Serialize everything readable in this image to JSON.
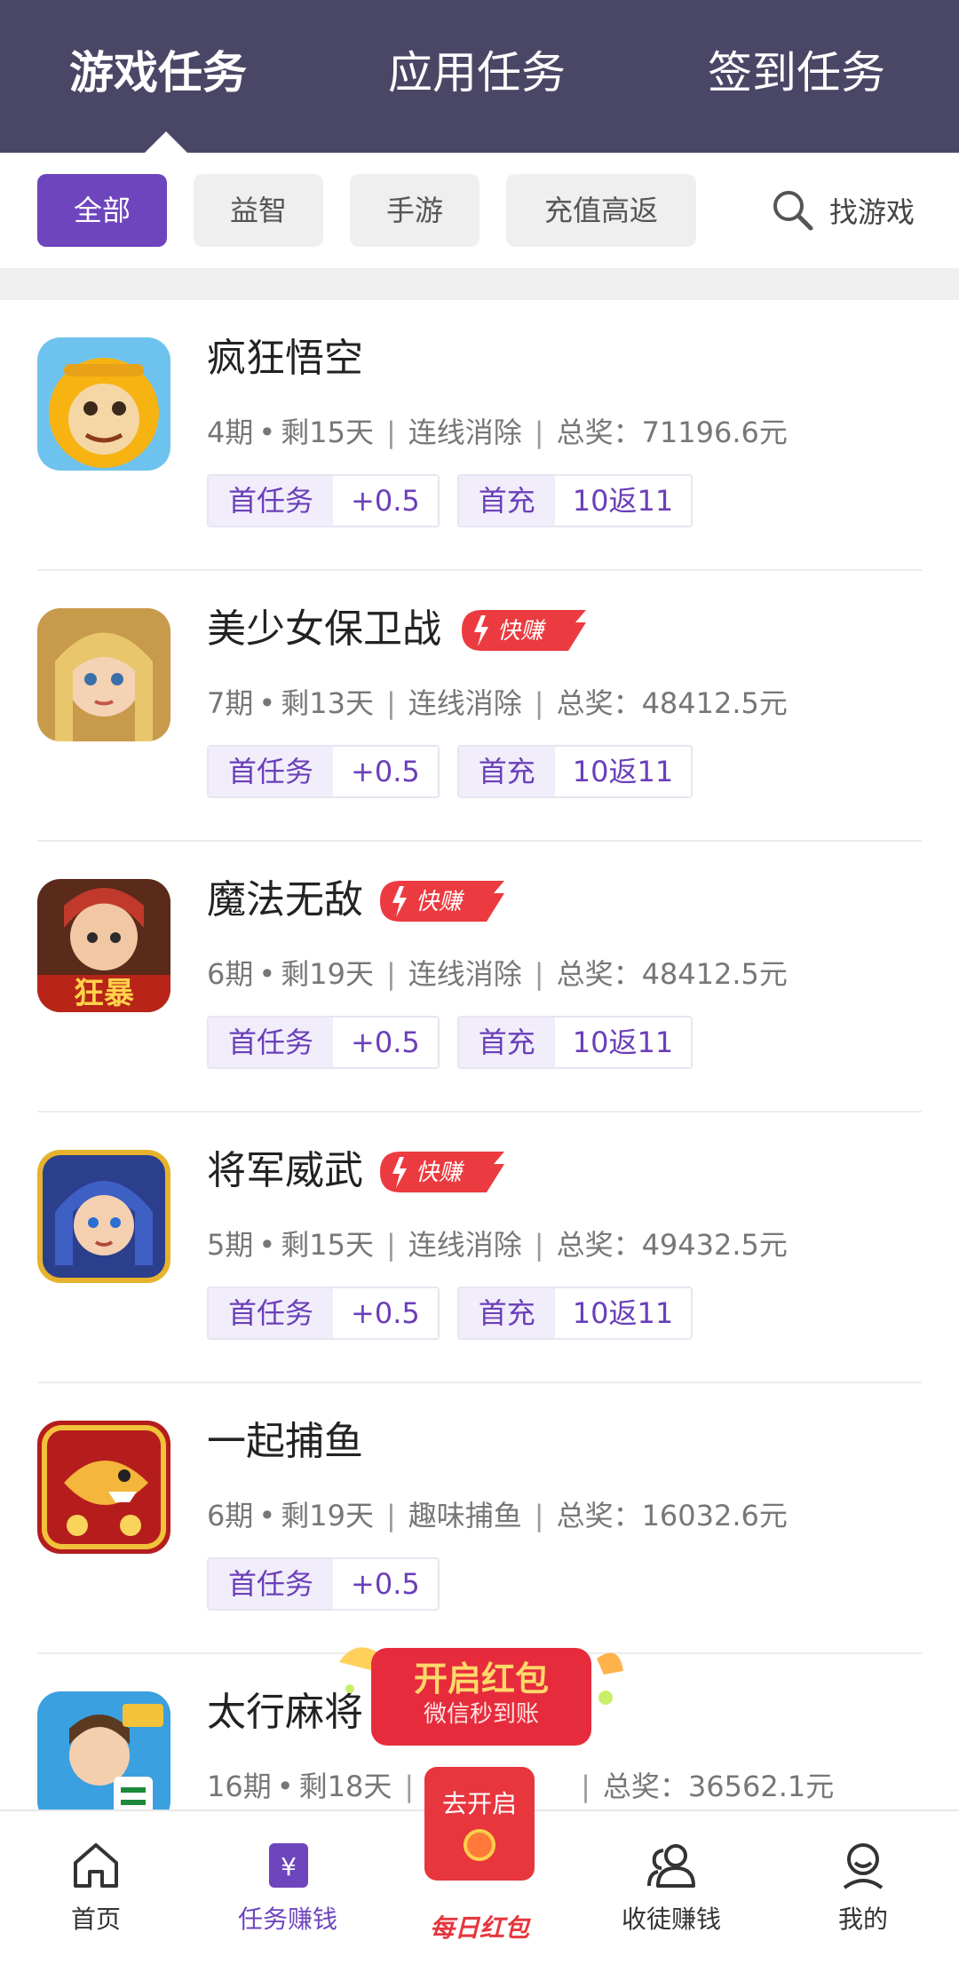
{
  "header": {
    "tabs": [
      {
        "label": "游戏任务",
        "active": true
      },
      {
        "label": "应用任务",
        "active": false
      },
      {
        "label": "签到任务",
        "active": false
      }
    ]
  },
  "filters": {
    "chips": [
      {
        "label": "全部",
        "active": true
      },
      {
        "label": "益智",
        "active": false
      },
      {
        "label": "手游",
        "active": false
      },
      {
        "label": "充值高返",
        "active": false
      }
    ],
    "search_label": "找游戏"
  },
  "badge_text": "快赚",
  "games": [
    {
      "name": "疯狂悟空",
      "issue": "4期",
      "remain": "剩15天",
      "category": "连线消除",
      "prize": "总奖：71196.6元",
      "fast": false,
      "tags": [
        {
          "k": "首任务",
          "v": "+0.5"
        },
        {
          "k": "首充",
          "v": "10返11"
        }
      ]
    },
    {
      "name": "美少女保卫战",
      "issue": "7期",
      "remain": "剩13天",
      "category": "连线消除",
      "prize": "总奖：48412.5元",
      "fast": true,
      "tags": [
        {
          "k": "首任务",
          "v": "+0.5"
        },
        {
          "k": "首充",
          "v": "10返11"
        }
      ]
    },
    {
      "name": "魔法无敌",
      "issue": "6期",
      "remain": "剩19天",
      "category": "连线消除",
      "prize": "总奖：48412.5元",
      "fast": true,
      "tags": [
        {
          "k": "首任务",
          "v": "+0.5"
        },
        {
          "k": "首充",
          "v": "10返11"
        }
      ]
    },
    {
      "name": "将军威武",
      "issue": "5期",
      "remain": "剩15天",
      "category": "连线消除",
      "prize": "总奖：49432.5元",
      "fast": true,
      "tags": [
        {
          "k": "首任务",
          "v": "+0.5"
        },
        {
          "k": "首充",
          "v": "10返11"
        }
      ]
    },
    {
      "name": "一起捕鱼",
      "issue": "6期",
      "remain": "剩19天",
      "category": "趣味捕鱼",
      "prize": "总奖：16032.6元",
      "fast": false,
      "tags": [
        {
          "k": "首任务",
          "v": "+0.5"
        }
      ]
    },
    {
      "name": "太行麻将",
      "issue": "16期",
      "remain": "剩18天",
      "category": "",
      "prize": "总奖：36562.1元",
      "fast": false,
      "tags": []
    }
  ],
  "promo": {
    "title": "开启红包",
    "subtitle": "微信秒到账"
  },
  "bottom_nav": {
    "home": "首页",
    "tasks": "任务赚钱",
    "center_button": "去开启",
    "center_label": "每日红包",
    "invite": "收徒赚钱",
    "mine": "我的"
  }
}
